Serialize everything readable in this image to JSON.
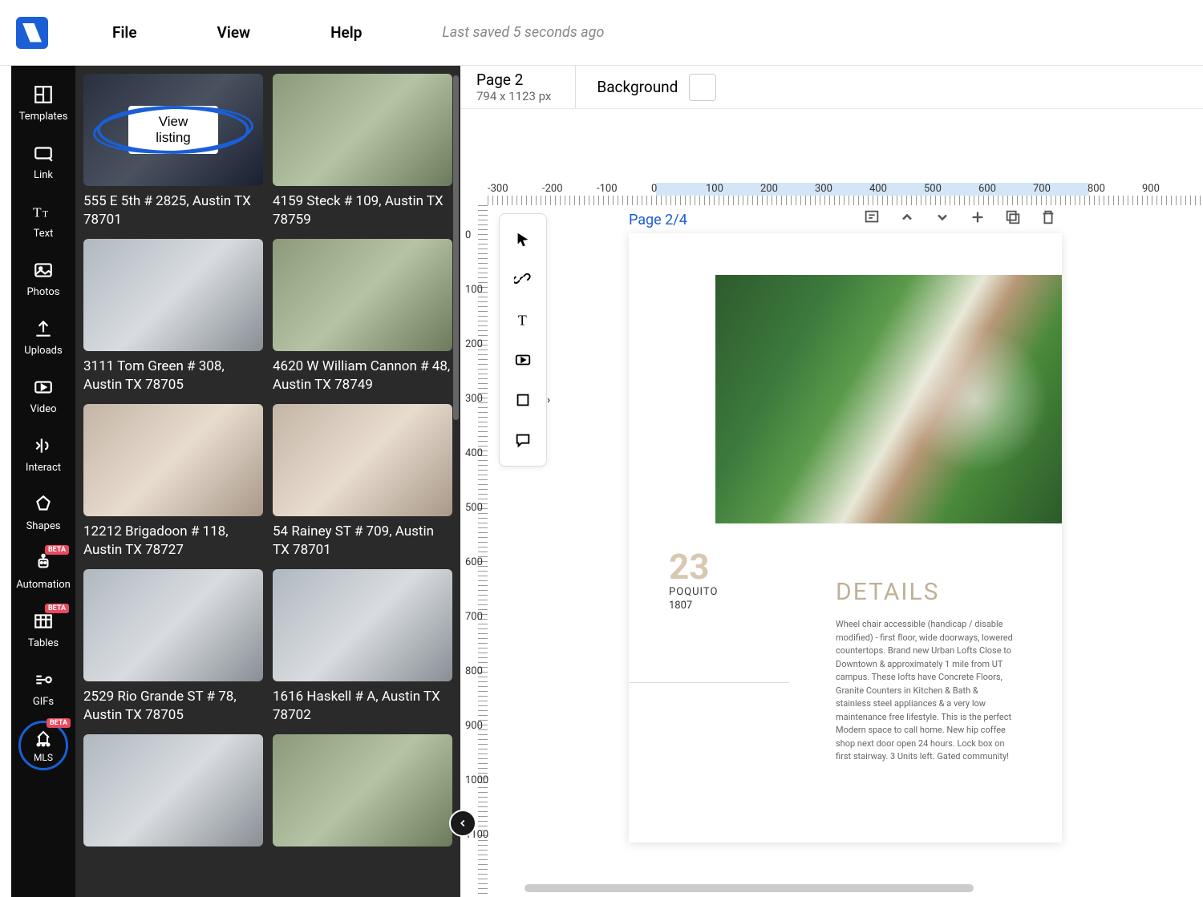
{
  "menu": {
    "file": "File",
    "view": "View",
    "help": "Help"
  },
  "saved": "Last saved 5 seconds ago",
  "rail": {
    "templates": "Templates",
    "link": "Link",
    "text": "Text",
    "photos": "Photos",
    "uploads": "Uploads",
    "video": "Video",
    "interact": "Interact",
    "shapes": "Shapes",
    "automation": "Automation",
    "tables": "Tables",
    "gifs": "GIFs",
    "mls": "MLS",
    "beta": "BETA"
  },
  "view_listing": "View listing",
  "listings": [
    {
      "addr": "555 E 5th # 2825, Austin TX 78701",
      "cls": "dark"
    },
    {
      "addr": "4159 Steck # 109, Austin TX 78759",
      "cls": ""
    },
    {
      "addr": "3111 Tom Green # 308, Austin TX 78705",
      "cls": "front"
    },
    {
      "addr": "4620 W William Cannon # 48, Austin TX 78749",
      "cls": ""
    },
    {
      "addr": "12212 Brigadoon # 118, Austin TX 78727",
      "cls": "interior"
    },
    {
      "addr": "54 Rainey ST # 709, Austin TX 78701",
      "cls": "interior"
    },
    {
      "addr": "2529 Rio Grande ST # 78, Austin TX 78705",
      "cls": "front"
    },
    {
      "addr": "1616 Haskell # A, Austin TX 78702",
      "cls": "front"
    },
    {
      "addr": "",
      "cls": "front"
    },
    {
      "addr": "",
      "cls": ""
    }
  ],
  "page_header": {
    "page": "Page 2",
    "dims": "794 x 1123 px",
    "bg_label": "Background"
  },
  "hruler": [
    "-300",
    "-200",
    "-100",
    "0",
    "100",
    "200",
    "300",
    "400",
    "500",
    "600",
    "700",
    "800",
    "900"
  ],
  "vruler": [
    "0",
    "100",
    "200",
    "300",
    "400",
    "500",
    "600",
    "700",
    "800",
    "900",
    "1000",
    "1100"
  ],
  "page_indicator": "Page 2/4",
  "doc": {
    "num": "23",
    "sub1": "POQUITO",
    "sub2": "1807",
    "heading": "DETAILS",
    "body": "Wheel chair accessible (handicap / disable modified) - first floor, wide doorways, lowered countertops. Brand new Urban Lofts Close to Downtown & approximately 1 mile from UT campus. These lofts have Concrete Floors, Granite Counters in Kitchen &  Bath & stainless steel appliances & a very low maintenance free lifestyle. This is the perfect Modern space to call home. New hip  coffee shop next door open 24 hours. Lock box on first stairway. 3 Units left. Gated community!"
  }
}
